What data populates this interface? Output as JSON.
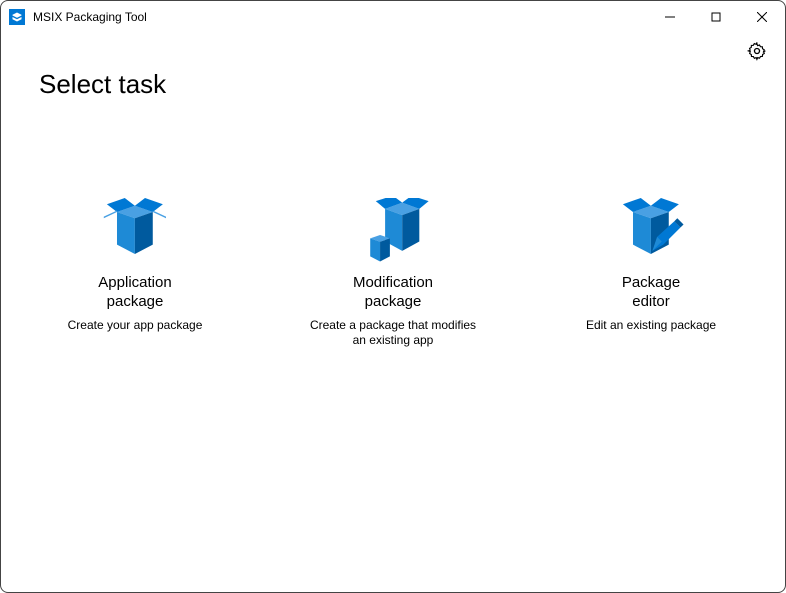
{
  "window": {
    "title": "MSIX Packaging Tool"
  },
  "header": {
    "page_title": "Select task"
  },
  "tasks": {
    "app_package": {
      "title": "Application\npackage",
      "desc": "Create your app package"
    },
    "mod_package": {
      "title": "Modification\npackage",
      "desc": "Create a package that modifies\nan existing app"
    },
    "pkg_editor": {
      "title": "Package\neditor",
      "desc": "Edit an existing package"
    }
  },
  "colors": {
    "accent": "#0078d4"
  }
}
